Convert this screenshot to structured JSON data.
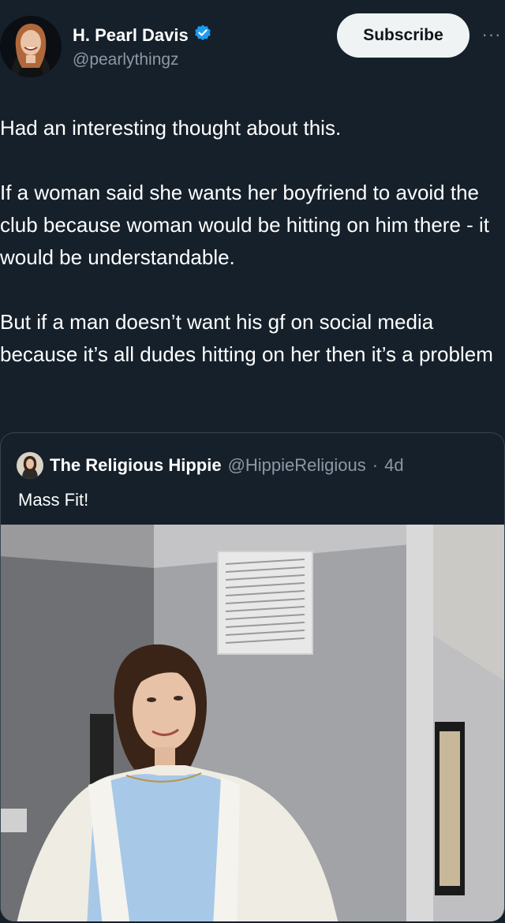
{
  "author": {
    "display_name": "H. Pearl Davis",
    "handle": "@pearlythingz",
    "avatar_icon": "profile-avatar",
    "verified_icon": "verified-badge-icon",
    "verified_color": "#1d9bf0"
  },
  "actions": {
    "subscribe_label": "Subscribe",
    "more_label": "···"
  },
  "tweet": {
    "paragraphs": [
      "Had an interesting thought about this.",
      "If a woman said she wants her boyfriend to avoid the club because woman would be hitting on him there - it would be understandable.",
      "But if a man doesn’t want his gf on social media because it’s all dudes hitting on her then it’s a problem"
    ]
  },
  "quoted_tweet": {
    "display_name": "The Religious Hippie",
    "handle": "@HippieReligious",
    "separator": "·",
    "time": "4d",
    "text": "Mass Fit!",
    "image_icon": "quoted-photo"
  },
  "colors": {
    "background": "#15202b",
    "text": "#ffffff",
    "secondary_text": "#8b98a5",
    "border": "#38444d",
    "button_bg": "#eff3f4"
  }
}
